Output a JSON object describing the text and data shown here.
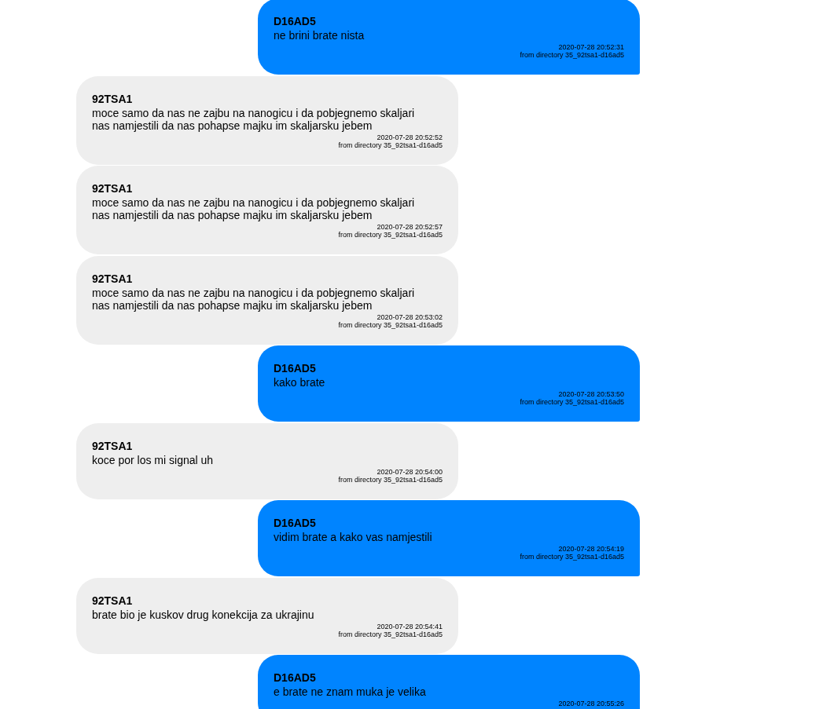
{
  "messages": [
    {
      "kind": "sent",
      "sender": "D16AD5",
      "text": "ne brini brate nista",
      "timestamp": "2020-07-28 20:52:31",
      "directory": "from directory 35_92tsa1-d16ad5"
    },
    {
      "kind": "received",
      "sender": "92TSA1",
      "text": "moce samo da nas ne zajbu na nanogicu i da pobjegnemo skaljari nas namjestili da nas pohapse majku im skaljarsku jebem",
      "timestamp": "2020-07-28 20:52:52",
      "directory": "from directory 35_92tsa1-d16ad5"
    },
    {
      "kind": "received",
      "sender": "92TSA1",
      "text": "moce samo da nas ne zajbu na nanogicu i da pobjegnemo skaljari nas namjestili da nas pohapse majku im skaljarsku jebem",
      "timestamp": "2020-07-28 20:52:57",
      "directory": "from directory 35_92tsa1-d16ad5"
    },
    {
      "kind": "received",
      "sender": "92TSA1",
      "text": "moce samo da nas ne zajbu na nanogicu i da pobjegnemo skaljari nas namjestili da nas pohapse majku im skaljarsku jebem",
      "timestamp": "2020-07-28 20:53:02",
      "directory": "from directory 35_92tsa1-d16ad5"
    },
    {
      "kind": "sent",
      "sender": "D16AD5",
      "text": "kako brate",
      "timestamp": "2020-07-28 20:53:50",
      "directory": "from directory 35_92tsa1-d16ad5"
    },
    {
      "kind": "received",
      "sender": "92TSA1",
      "text": "koce por los mi signal uh",
      "timestamp": "2020-07-28 20:54:00",
      "directory": "from directory 35_92tsa1-d16ad5"
    },
    {
      "kind": "sent",
      "sender": "D16AD5",
      "text": "vidim brate a kako vas namjestili",
      "timestamp": "2020-07-28 20:54:19",
      "directory": "from directory 35_92tsa1-d16ad5"
    },
    {
      "kind": "received",
      "sender": "92TSA1",
      "text": "brate bio je kuskov drug konekcija za ukrajinu",
      "timestamp": "2020-07-28 20:54:41",
      "directory": "from directory 35_92tsa1-d16ad5"
    },
    {
      "kind": "sent",
      "sender": "D16AD5",
      "text": "e brate ne znam muka je velika",
      "timestamp": "2020-07-28 20:55:26"
    }
  ]
}
